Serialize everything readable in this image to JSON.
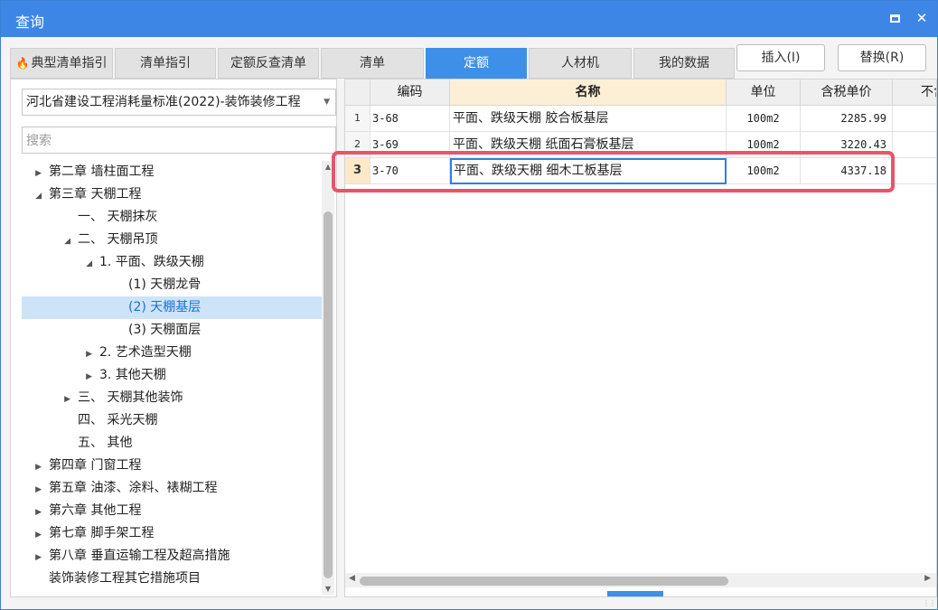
{
  "window": {
    "title": "查询",
    "maximize_icon": "maximize-icon",
    "close_icon": "close-icon",
    "close_glyph": "✕"
  },
  "tabs": [
    {
      "label": "典型清单指引",
      "icon": "fire-icon"
    },
    {
      "label": "清单指引"
    },
    {
      "label": "定额反查清单"
    },
    {
      "label": "清单"
    },
    {
      "label": "定额",
      "active": true
    },
    {
      "label": "人材机"
    },
    {
      "label": "我的数据"
    }
  ],
  "actions": {
    "insert": "插入(I)",
    "replace": "替换(R)"
  },
  "left": {
    "dropdown_value": "河北省建设工程消耗量标准(2022)-装饰装修工程",
    "search_placeholder": "搜索",
    "tree": [
      {
        "label": "第二章 墙柱面工程",
        "expander": "collapsed"
      },
      {
        "label": "第三章 天棚工程",
        "expander": "expanded"
      },
      {
        "label": "一、 天棚抹灰",
        "expander": "none"
      },
      {
        "label": "二、 天棚吊顶",
        "expander": "expanded"
      },
      {
        "label": "1. 平面、跌级天棚",
        "expander": "expanded"
      },
      {
        "label": "(1) 天棚龙骨",
        "expander": "none"
      },
      {
        "label": "(2) 天棚基层",
        "expander": "none",
        "selected": true
      },
      {
        "label": "(3) 天棚面层",
        "expander": "none"
      },
      {
        "label": "2. 艺术造型天棚",
        "expander": "collapsed"
      },
      {
        "label": "3. 其他天棚",
        "expander": "collapsed"
      },
      {
        "label": "三、 天棚其他装饰",
        "expander": "collapsed"
      },
      {
        "label": "四、 采光天棚",
        "expander": "none"
      },
      {
        "label": "五、 其他",
        "expander": "none"
      },
      {
        "label": "第四章 门窗工程",
        "expander": "collapsed"
      },
      {
        "label": "第五章 油漆、涂料、裱糊工程",
        "expander": "collapsed"
      },
      {
        "label": "第六章 其他工程",
        "expander": "collapsed"
      },
      {
        "label": "第七章 脚手架工程",
        "expander": "collapsed"
      },
      {
        "label": "第八章 垂直运输工程及超高措施",
        "expander": "collapsed"
      },
      {
        "label": "装饰装修工程其它措施项目",
        "expander": "none"
      }
    ]
  },
  "grid": {
    "headers": [
      "编码",
      "名称",
      "单位",
      "含税单价",
      "不含"
    ],
    "rows": [
      {
        "no": "1",
        "code": "3-68",
        "name": "平面、跌级天棚 胶合板基层",
        "unit": "100m2",
        "price": "2285.99"
      },
      {
        "no": "2",
        "code": "3-69",
        "name": "平面、跌级天棚 纸面石膏板基层",
        "unit": "100m2",
        "price": "3220.43"
      },
      {
        "no": "3",
        "code": "3-70",
        "name": "平面、跌级天棚 细木工板基层",
        "unit": "100m2",
        "price": "4337.18",
        "current": true
      }
    ],
    "highlight_color": "#e8546a"
  },
  "colors": {
    "title_bar": "#3e86e6",
    "active_tab": "#3e8fe8",
    "selection": "#cde3f8"
  }
}
